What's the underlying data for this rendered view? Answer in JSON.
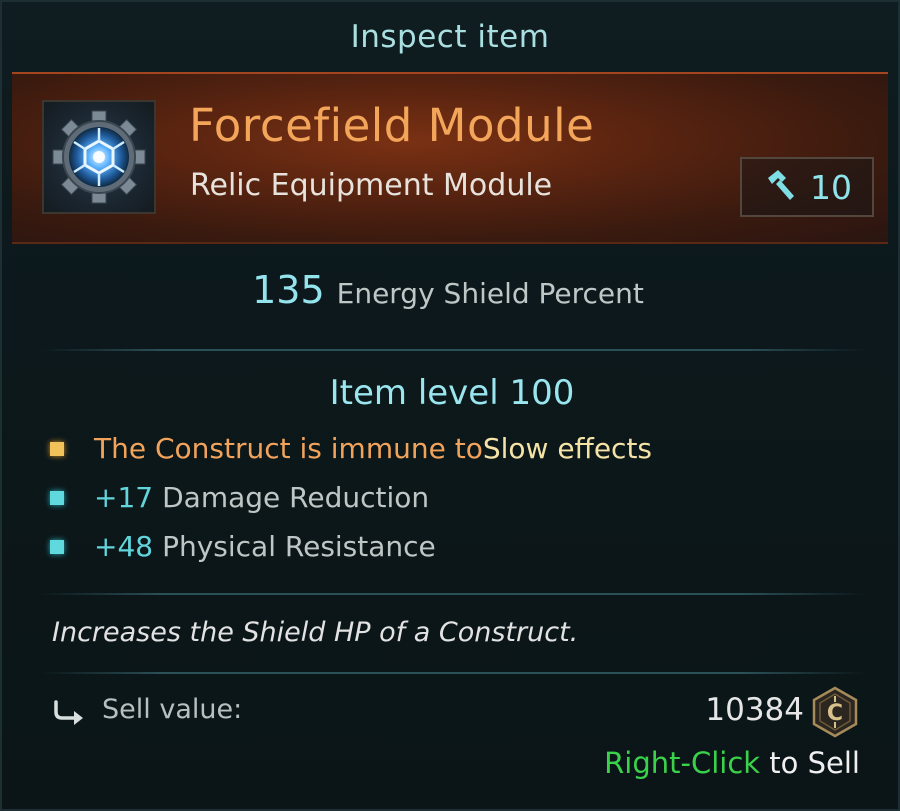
{
  "window": {
    "title": "Inspect item"
  },
  "item": {
    "name": "Forcefield Module",
    "type": "Relic Equipment Module",
    "icon": "forcefield-gear-icon",
    "required_level": "10",
    "level_icon": "hammer-icon",
    "name_color": "#f3a55a"
  },
  "main_stat": {
    "value": "135",
    "label": "Energy Shield Percent"
  },
  "item_level": "Item level 100",
  "properties": [
    {
      "bullet": "gold",
      "text_a": "The Construct is immune to ",
      "text_b": "Slow effects"
    },
    {
      "bullet": "cyan",
      "value": "+17",
      "label": "Damage Reduction"
    },
    {
      "bullet": "cyan",
      "value": "+48",
      "label": "Physical Resistance"
    }
  ],
  "description": "Increases the Shield HP of a Construct.",
  "sell": {
    "label": "Sell value:",
    "value": "10384",
    "currency_icon": "credit-coin-icon",
    "arrow_icon": "return-arrow-icon"
  },
  "hint": {
    "action": "Right-Click",
    "rest": " to Sell",
    "action_color": "#39d24a"
  }
}
